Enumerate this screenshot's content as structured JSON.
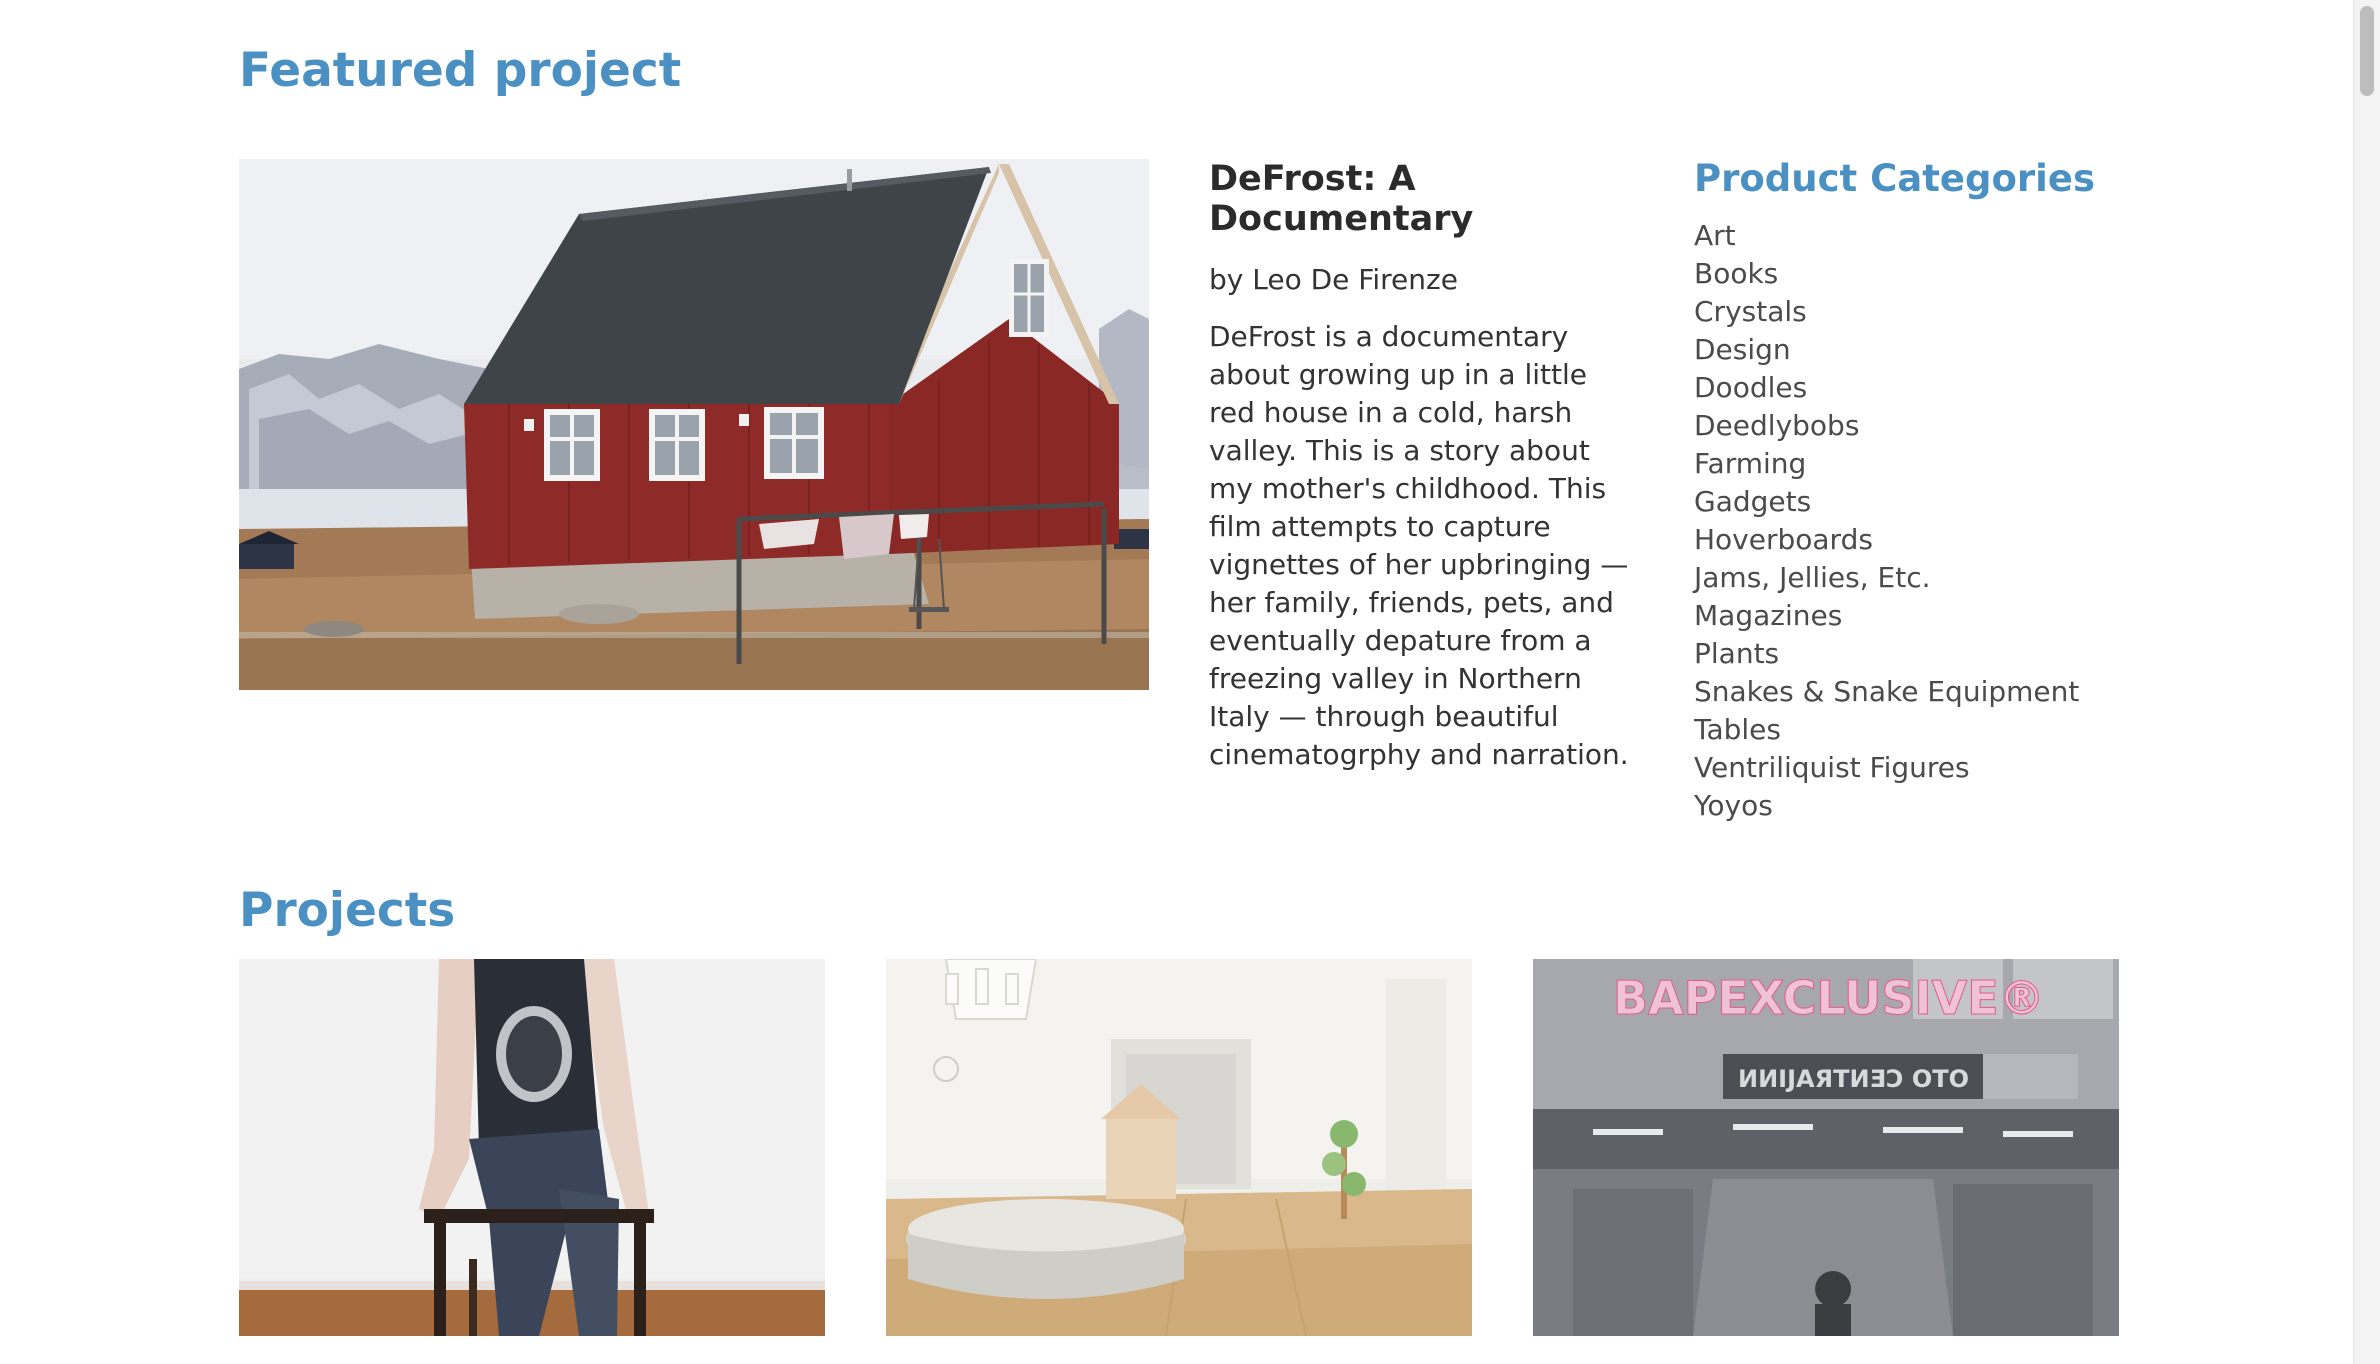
{
  "featured": {
    "section_title": "Featured project",
    "project": {
      "title": "DeFrost: A Documentary",
      "author": "by Leo De Firenze",
      "description": "DeFrost is a documentary about growing up in a little red house in a cold, harsh valley. This is a story about my mother's childhood. This film attempts to capture vignettes of her upbringing — her family, friends, pets, and eventually depature from a freezing valley in Northern Italy — through beautiful cinematogrphy and narration."
    }
  },
  "categories": {
    "title": "Product Categories",
    "items": [
      "Art",
      "Books",
      "Crystals",
      "Design",
      "Doodles",
      "Deedlybobs",
      "Farming",
      "Gadgets",
      "Hoverboards",
      "Jams, Jellies, Etc.",
      "Magazines",
      "Plants",
      "Snakes & Snake Equipment",
      "Tables",
      "Ventriliquist Figures",
      "Yoyos"
    ]
  },
  "projects": {
    "section_title": "Projects"
  },
  "colors": {
    "accent": "#4a90c2",
    "text": "#333333",
    "house_red": "#8e2a28",
    "roof": "#3f4448"
  }
}
